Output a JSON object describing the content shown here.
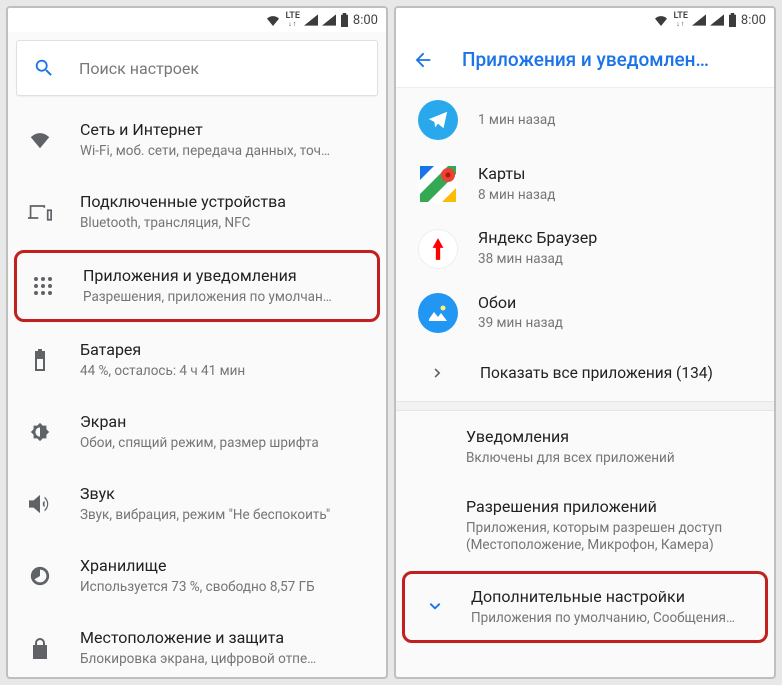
{
  "status": {
    "time": "8:00",
    "lte": "LTE"
  },
  "left": {
    "search_placeholder": "Поиск настроек",
    "items": [
      {
        "title": "Сеть и Интернет",
        "sub": "Wi-Fi, моб. сети, передача данных, точ…"
      },
      {
        "title": "Подключенные устройства",
        "sub": "Bluetooth, трансляция, NFC"
      },
      {
        "title": "Приложения и уведомления",
        "sub": "Разрешения, приложения по умолчан…"
      },
      {
        "title": "Батарея",
        "sub": "44 %, осталось: 4 ч 41 мин"
      },
      {
        "title": "Экран",
        "sub": "Обои, спящий режим, размер шрифта"
      },
      {
        "title": "Звук",
        "sub": "Звук, вибрация, режим \"Не беспокоить\""
      },
      {
        "title": "Хранилище",
        "sub": "Используется 73 %, свободно 8,57 ГБ"
      },
      {
        "title": "Местоположение и защита",
        "sub": "Блокировка экрана, цифровой отпе…"
      }
    ]
  },
  "right": {
    "topbar_title": "Приложения и уведомлен…",
    "apps": [
      {
        "name": "",
        "sub": "1 мин назад"
      },
      {
        "name": "Карты",
        "sub": "8 мин назад"
      },
      {
        "name": "Яндекс Браузер",
        "sub": "38 мин назад"
      },
      {
        "name": "Обои",
        "sub": "39 мин назад"
      }
    ],
    "show_all": "Показать все приложения (134)",
    "sections": [
      {
        "title": "Уведомления",
        "sub": "Включены для всех приложений"
      },
      {
        "title": "Разрешения приложений",
        "sub": "Приложения, которым разрешен доступ (Местоположение, Микрофон, Камера)"
      },
      {
        "title": "Дополнительные настройки",
        "sub": "Приложения по умолчанию, Сообщения…"
      }
    ]
  }
}
